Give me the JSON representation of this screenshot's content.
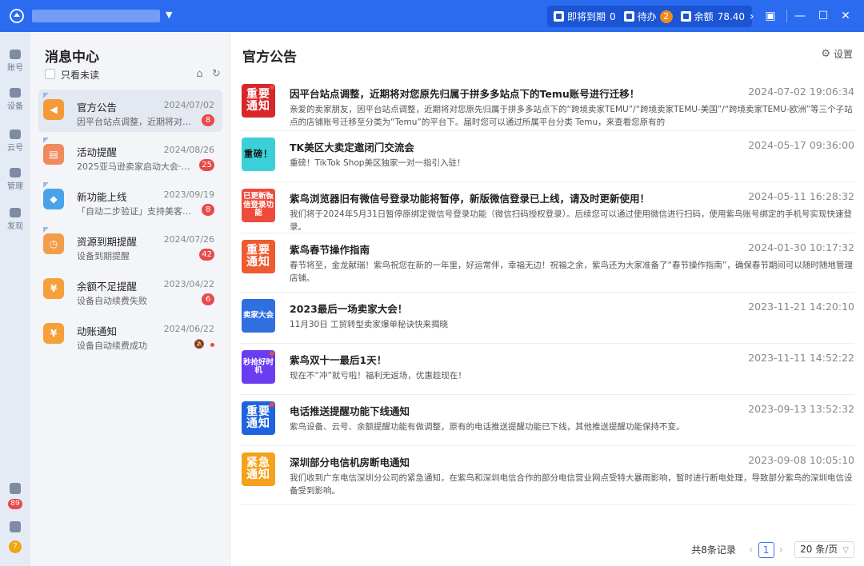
{
  "titlebar": {
    "status": {
      "expiring_label": "即将到期",
      "expiring_count": "0",
      "todo_label": "待办",
      "todo_count": "2",
      "balance_label": "余额",
      "balance_value": "78.40"
    }
  },
  "rail": {
    "items": [
      "账号",
      "设备",
      "云号",
      "管理",
      "发现"
    ],
    "badge": "89"
  },
  "message_center": {
    "title": "消息中心",
    "unread_only_label": "只看未读",
    "categories": [
      {
        "name": "官方公告",
        "date": "2024/07/02",
        "preview": "因平台站点调整，近期将对您...",
        "badge": "8",
        "color": "#f59a3a"
      },
      {
        "name": "活动提醒",
        "date": "2024/08/26",
        "preview": "2025亚马逊卖家启动大会·深...",
        "badge": "25",
        "color": "#f08a5d"
      },
      {
        "name": "新功能上线",
        "date": "2023/09/19",
        "preview": "「自动二步验证」支持美客多...",
        "badge": "8",
        "color": "#4aa3e8"
      },
      {
        "name": "资源到期提醒",
        "date": "2024/07/26",
        "preview": "设备到期提醒",
        "badge": "42",
        "color": "#f39c4a"
      },
      {
        "name": "余额不足提醒",
        "date": "2023/04/22",
        "preview": "设备自动续费失败",
        "badge": "6",
        "color": "#f5a03a"
      },
      {
        "name": "动账通知",
        "date": "2024/06/22",
        "preview": "设备自动续费成功",
        "badge": "",
        "color": "#f5a03a"
      }
    ]
  },
  "main": {
    "title": "官方公告",
    "settings_label": "设置",
    "notices": [
      {
        "title": "因平台站点调整，近期将对您原先归属于拼多多站点下的Temu账号进行迁移！",
        "time": "2024-07-02 19:06:34",
        "body": "亲爱的卖家朋友，因平台站点调整，近期将对您原先归属于拼多多站点下的“跨境卖家TEMU”/“跨境卖家TEMU-美国”/“跨境卖家TEMU-欧洲”等三个子站点的店铺账号迁移至分类为“Temu”的平台下。届时您可以通过所属平台分类 Temu，来查看您原有的",
        "thumb": "重要通知",
        "thumb_bg": "#d8262b"
      },
      {
        "title": "TK美区大卖定邀闭门交流会",
        "time": "2024-05-17 09:36:00",
        "body": "重磅！TikTok Shop美区独家一对一指引入驻！",
        "thumb": "重磅！",
        "thumb_bg": "#3bd0d8"
      },
      {
        "title": "紫鸟浏览器旧有微信号登录功能将暂停，新版微信登录已上线，请及时更新使用！",
        "time": "2024-05-11 16:28:32",
        "body": "我们将于2024年5月31日暂停原绑定微信号登录功能（微信扫码授权登录）。后续您可以通过使用微信进行扫码，使用紫鸟账号绑定的手机号实现快速登录。",
        "thumb": "已更新微信登录功能",
        "thumb_bg": "#ef4b3c"
      },
      {
        "title": "紫鸟春节操作指南",
        "time": "2024-01-30 10:17:32",
        "body": "春节将至，金龙献瑞！紫鸟祝您在新的一年里，好运常伴，幸福无边！祝福之余，紫鸟还为大家准备了“春节操作指南”，确保春节期间可以随时随地管理店铺。",
        "thumb": "重要通知",
        "thumb_bg": "#ef5a2e"
      },
      {
        "title": "2023最后一场卖家大会！",
        "time": "2023-11-21 14:20:10",
        "body": "11月30日 工贸转型卖家爆单秘诀快来揭晓",
        "thumb": "卖家大会",
        "thumb_bg": "#2f6fe0"
      },
      {
        "title": "紫鸟双十一最后1天！",
        "time": "2023-11-11 14:52:22",
        "body": "现在不“冲”就亏啦！福利无返场，优惠趁现在！",
        "thumb": "秒抢好时机",
        "thumb_bg": "#6a3df0"
      },
      {
        "title": "电话推送提醒功能下线通知",
        "time": "2023-09-13 13:52:32",
        "body": "紫鸟设备、云号、余额提醒功能有做调整，原有的电话推送提醒功能已下线，其他推送提醒功能保持不变。",
        "thumb": "重要通知",
        "thumb_bg": "#1f63e0"
      },
      {
        "title": "深圳部分电信机房断电通知",
        "time": "2023-09-08 10:05:10",
        "body": "我们收到广东电信深圳分公司的紧急通知，在紫鸟和深圳电信合作的部分电信营业网点受特大暴雨影响，暂时进行断电处理，导致部分紫鸟的深圳电信设备受到影响。",
        "thumb": "紧急通知",
        "thumb_bg": "#f4a21e"
      }
    ],
    "pagination": {
      "total": "共8条记录",
      "current_page": "1",
      "page_size": "20 条/页"
    }
  }
}
